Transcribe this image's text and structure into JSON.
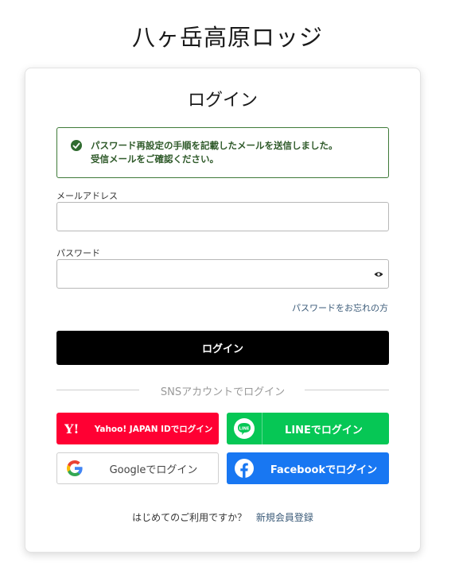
{
  "site": {
    "title": "八ヶ岳高原ロッジ"
  },
  "login": {
    "title": "ログイン",
    "notice": {
      "line1": "パスワード再設定の手順を記載したメールを送信しました。",
      "line2": "受信メールをご確認ください。"
    },
    "email_label": "メールアドレス",
    "email_value": "",
    "password_label": "パスワード",
    "password_value": "",
    "forgot_link": "パスワードをお忘れの方",
    "submit_label": "ログイン"
  },
  "sns": {
    "divider_text": "SNSアカウントでログイン",
    "yahoo": {
      "label": "Yahoo! JAPAN IDでログイン",
      "icon": "yahoo-icon",
      "color": "#ff0033"
    },
    "line": {
      "label": "LINEでログイン",
      "icon": "line-icon",
      "color": "#06c755"
    },
    "google": {
      "label": "Googleでログイン",
      "icon": "google-icon"
    },
    "facebook": {
      "label": "Facebookでログイン",
      "icon": "facebook-icon",
      "color": "#1877f2"
    }
  },
  "signup": {
    "question": "はじめてのご利用ですか？",
    "link": "新規会員登録"
  }
}
